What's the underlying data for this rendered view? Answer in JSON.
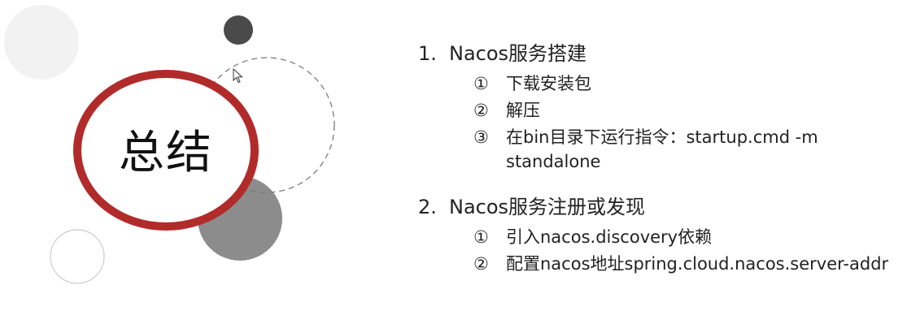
{
  "slide": {
    "title": "总结",
    "colors": {
      "accent_ring": "#b22b2b",
      "dark_circle": "#4a4a4a",
      "mid_circle": "#8c8c8c",
      "light_circle": "#f2f2f2",
      "outline_circle": "#cccccc",
      "dashed_circle": "#7a7a7a"
    }
  },
  "outline": {
    "sections": [
      {
        "number": "1.",
        "title": "Nacos服务搭建",
        "items": [
          {
            "marker": "①",
            "text": "下载安装包"
          },
          {
            "marker": "②",
            "text": "解压"
          },
          {
            "marker": "③",
            "text": "在bin目录下运行指令：startup.cmd -m standalone"
          }
        ]
      },
      {
        "number": "2.",
        "title": "Nacos服务注册或发现",
        "items": [
          {
            "marker": "①",
            "text": "引入nacos.discovery依赖"
          },
          {
            "marker": "②",
            "text": "配置nacos地址spring.cloud.nacos.server-addr"
          }
        ]
      }
    ]
  }
}
